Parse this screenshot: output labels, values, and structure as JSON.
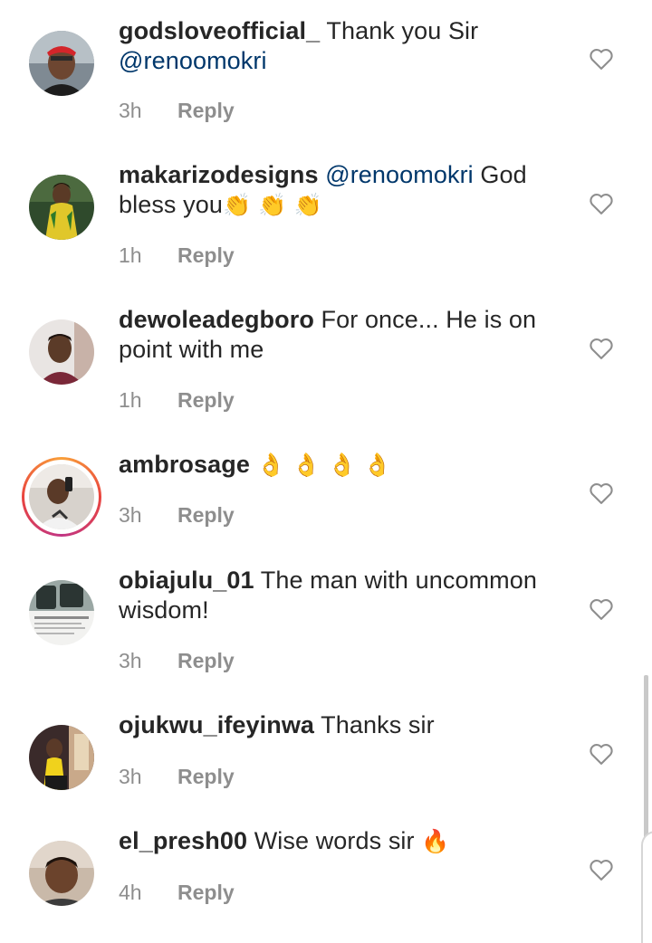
{
  "comments": [
    {
      "username": "godsloveofficial_",
      "text_before": " Thank you Sir ",
      "mention": "@renoomokri",
      "text_after": "",
      "emoji": "",
      "time": "3h",
      "reply": "Reply",
      "has_story": false
    },
    {
      "username": "makarizodesigns",
      "text_before": " ",
      "mention": "@renoomokri",
      "text_after": " God bless you",
      "emoji": "👏 👏 👏",
      "time": "1h",
      "reply": "Reply",
      "has_story": false
    },
    {
      "username": "dewoleadegboro",
      "text_before": " For once... He is on point with me",
      "mention": "",
      "text_after": "",
      "emoji": "",
      "time": "1h",
      "reply": "Reply",
      "has_story": false
    },
    {
      "username": "ambrosage",
      "text_before": " ",
      "mention": "",
      "text_after": "",
      "emoji": "👌 👌 👌 👌",
      "time": "3h",
      "reply": "Reply",
      "has_story": true
    },
    {
      "username": "obiajulu_01",
      "text_before": " The man with uncommon wisdom!",
      "mention": "",
      "text_after": "",
      "emoji": "",
      "time": "3h",
      "reply": "Reply",
      "has_story": false
    },
    {
      "username": "ojukwu_ifeyinwa",
      "text_before": " Thanks sir",
      "mention": "",
      "text_after": "",
      "emoji": "",
      "time": "3h",
      "reply": "Reply",
      "has_story": false
    },
    {
      "username": "el_presh00",
      "text_before": " Wise words sir ",
      "mention": "",
      "text_after": "",
      "emoji": "🔥",
      "time": "4h",
      "reply": "Reply",
      "has_story": false
    }
  ],
  "icons": {
    "like": "heart-outline-icon"
  },
  "colors": {
    "text": "#262626",
    "mention": "#00376b",
    "meta": "#8e8e8e",
    "heart": "#8e8e8e"
  }
}
